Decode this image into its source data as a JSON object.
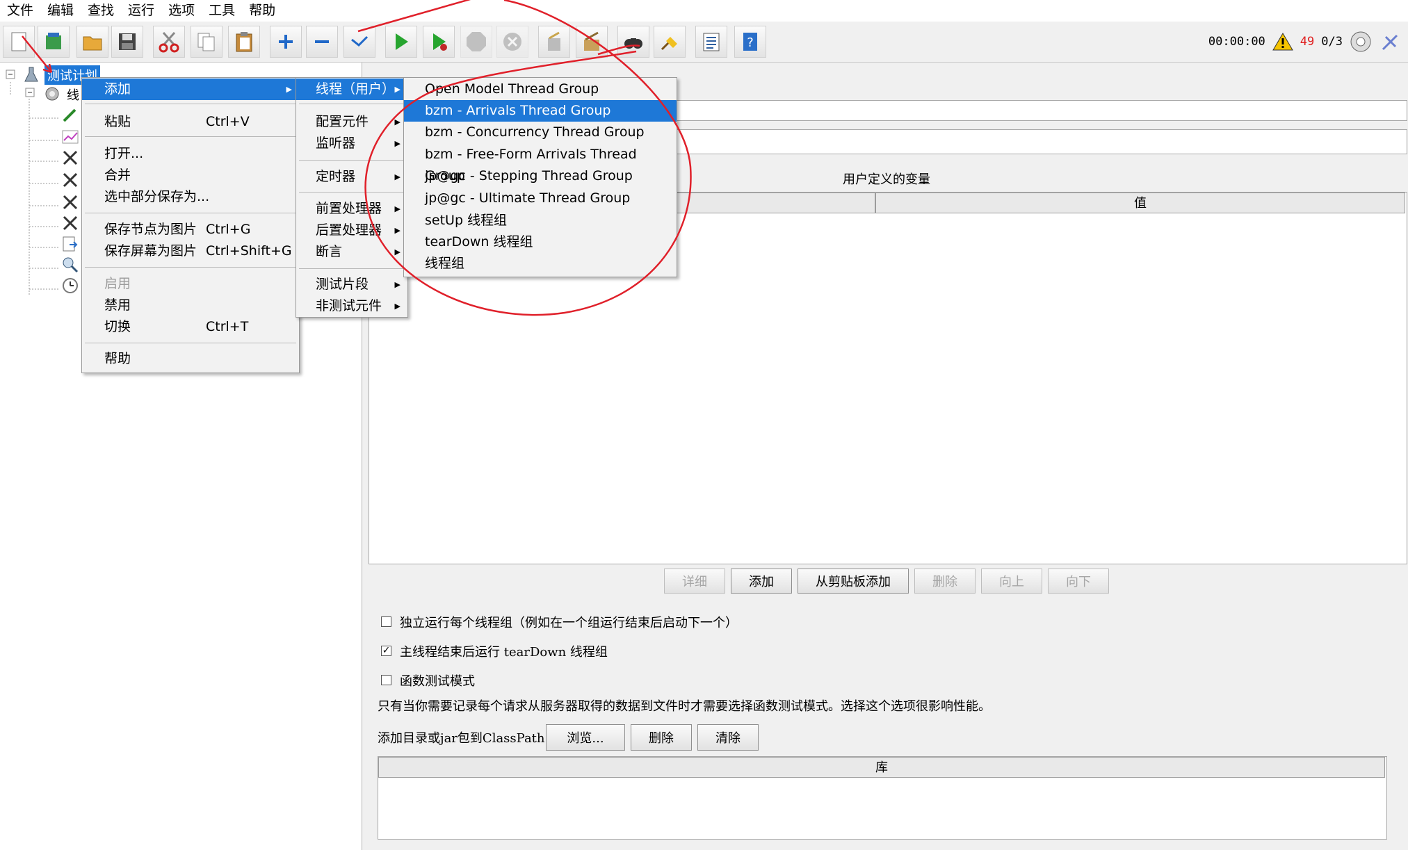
{
  "menubar": [
    "文件",
    "编辑",
    "查找",
    "运行",
    "选项",
    "工具",
    "帮助"
  ],
  "toolbar": {
    "timer": "00:00:00",
    "warning_count": "49",
    "thread_ratio": "0/3",
    "icons": [
      "new-icon",
      "templates-icon",
      "open-icon",
      "save-icon",
      "cut-icon",
      "copy-icon",
      "paste-icon",
      "expand-icon",
      "collapse-icon",
      "toggle-icon",
      "start-icon",
      "start-no-pause-icon",
      "stop-icon",
      "shutdown-icon",
      "clear-icon",
      "clear-all-icon",
      "search-icon",
      "reset-search-icon",
      "function-helper-icon",
      "help-icon"
    ]
  },
  "tree": {
    "root_label": "测试计划",
    "child_label": "线"
  },
  "context_menu": {
    "items": [
      {
        "label": "添加",
        "shortcut": "",
        "submenu": true
      },
      {
        "label": "粘贴",
        "shortcut": "Ctrl+V"
      },
      {
        "label": "打开...",
        "shortcut": ""
      },
      {
        "label": "合并",
        "shortcut": ""
      },
      {
        "label": "选中部分保存为...",
        "shortcut": ""
      },
      {
        "label": "保存节点为图片",
        "shortcut": "Ctrl+G"
      },
      {
        "label": "保存屏幕为图片",
        "shortcut": "Ctrl+Shift+G"
      },
      {
        "label": "启用",
        "shortcut": "",
        "disabled": true
      },
      {
        "label": "禁用",
        "shortcut": ""
      },
      {
        "label": "切换",
        "shortcut": "Ctrl+T"
      },
      {
        "label": "帮助",
        "shortcut": ""
      }
    ]
  },
  "add_submenu": {
    "items": [
      "线程（用户）",
      "配置元件",
      "监听器",
      "定时器",
      "前置处理器",
      "后置处理器",
      "断言",
      "测试片段",
      "非测试元件"
    ]
  },
  "thread_submenu": {
    "items": [
      "Open Model Thread Group",
      "bzm - Arrivals Thread Group",
      "bzm - Concurrency Thread Group",
      "bzm - Free-Form Arrivals Thread Group",
      "jp@gc - Stepping Thread Group",
      "jp@gc - Ultimate Thread Group",
      "setUp 线程组",
      "tearDown 线程组",
      "线程组"
    ],
    "highlighted": "bzm - Arrivals Thread Group"
  },
  "right_panel": {
    "vars_title": "用户定义的变量",
    "value_header": "值",
    "buttons": {
      "detail": "详细",
      "add": "添加",
      "add_clipboard": "从剪贴板添加",
      "delete": "删除",
      "up": "向上",
      "down": "向下"
    },
    "checkbox1": "独立运行每个线程组（例如在一个组运行结束后启动下一个）",
    "checkbox2": "主线程结束后运行 tearDown 线程组",
    "checkbox3": "函数测试模式",
    "checkbox1_checked": false,
    "checkbox2_checked": true,
    "checkbox3_checked": false,
    "functional_note": "只有当你需要记录每个请求从服务器取得的数据到文件时才需要选择函数测试模式。选择这个选项很影响性能。",
    "classpath_label": "添加目录或jar包到ClassPath",
    "browse": "浏览...",
    "remove": "删除",
    "clear": "清除",
    "library_header": "库"
  },
  "colors": {
    "highlight": "#1e78d7",
    "annotation_red": "#e0202a",
    "warning_count": "#e02020"
  }
}
